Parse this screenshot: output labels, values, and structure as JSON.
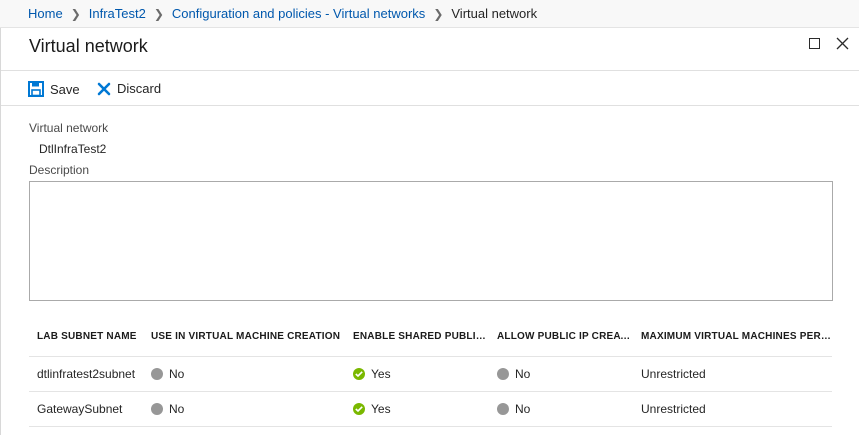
{
  "breadcrumb": {
    "items": [
      "Home",
      "InfraTest2",
      "Configuration and policies - Virtual networks"
    ],
    "current": "Virtual network"
  },
  "blade": {
    "title": "Virtual network"
  },
  "toolbar": {
    "save_label": "Save",
    "discard_label": "Discard"
  },
  "form": {
    "vnet_label": "Virtual network",
    "vnet_value": "DtlInfraTest2",
    "description_label": "Description",
    "description_value": ""
  },
  "table": {
    "headers": [
      "LAB SUBNET NAME",
      "USE IN VIRTUAL MACHINE CREATION",
      "ENABLE SHARED PUBLIC IP",
      "ALLOW PUBLIC IP CREATI...",
      "MAXIMUM VIRTUAL MACHINES PER U..."
    ],
    "rows": [
      {
        "name": "dtlinfratest2subnet",
        "use_in_vm": "No",
        "shared_ip": "Yes",
        "allow_public_ip": "No",
        "max_vms": "Unrestricted"
      },
      {
        "name": "GatewaySubnet",
        "use_in_vm": "No",
        "shared_ip": "Yes",
        "allow_public_ip": "No",
        "max_vms": "Unrestricted"
      }
    ]
  },
  "colors": {
    "link": "#0058ad",
    "accent": "#0078d4",
    "status_yes": "#7ab800",
    "status_no": "#979797"
  },
  "icons": {
    "save": "save-icon",
    "discard": "discard-icon",
    "maximize": "maximize-icon",
    "close": "close-icon",
    "status_yes": "check-circle-icon",
    "status_no": "gray-circle-icon"
  }
}
